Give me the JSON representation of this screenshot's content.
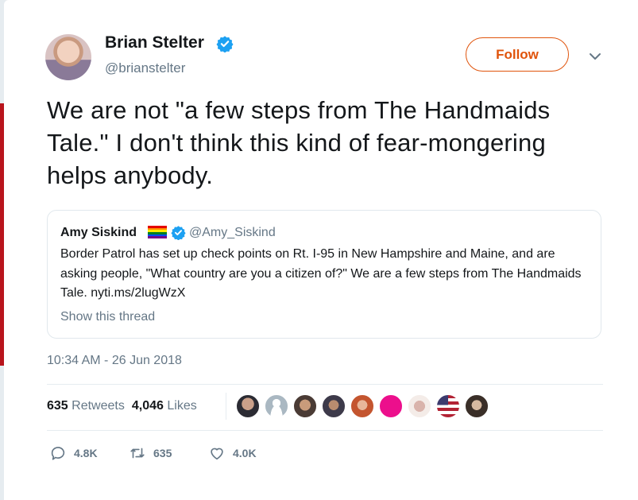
{
  "author": {
    "display_name": "Brian Stelter",
    "handle": "@brianstelter",
    "verified": true,
    "follow_label": "Follow"
  },
  "tweet": {
    "text": "We are not \"a few steps from The Handmaids Tale.\" I don't think this kind of fear-mongering helps anybody.",
    "timestamp": "10:34 AM - 26 Jun 2018"
  },
  "quoted_tweet": {
    "display_name": "Amy Siskind",
    "flag_icon": "rainbow-flag-icon",
    "verified": true,
    "handle": "@Amy_Siskind",
    "text": "Border Patrol has set up check points on Rt. I-95 in New Hampshire and Maine, and are asking people, \"What country are you a citizen of?\" We are a few steps from The Handmaids Tale. nyti.ms/2lugWzX",
    "thread_link": "Show this thread"
  },
  "stats": {
    "retweets_count": "635",
    "retweets_label": "Retweets",
    "likes_count": "4,046",
    "likes_label": "Likes",
    "liker_avatars": 9
  },
  "actions": {
    "reply_count": "4.8K",
    "retweet_count": "635",
    "like_count": "4.0K"
  },
  "colors": {
    "accent_orange": "#e0540c",
    "verified_blue": "#1da1f2",
    "muted_gray": "#657786"
  }
}
